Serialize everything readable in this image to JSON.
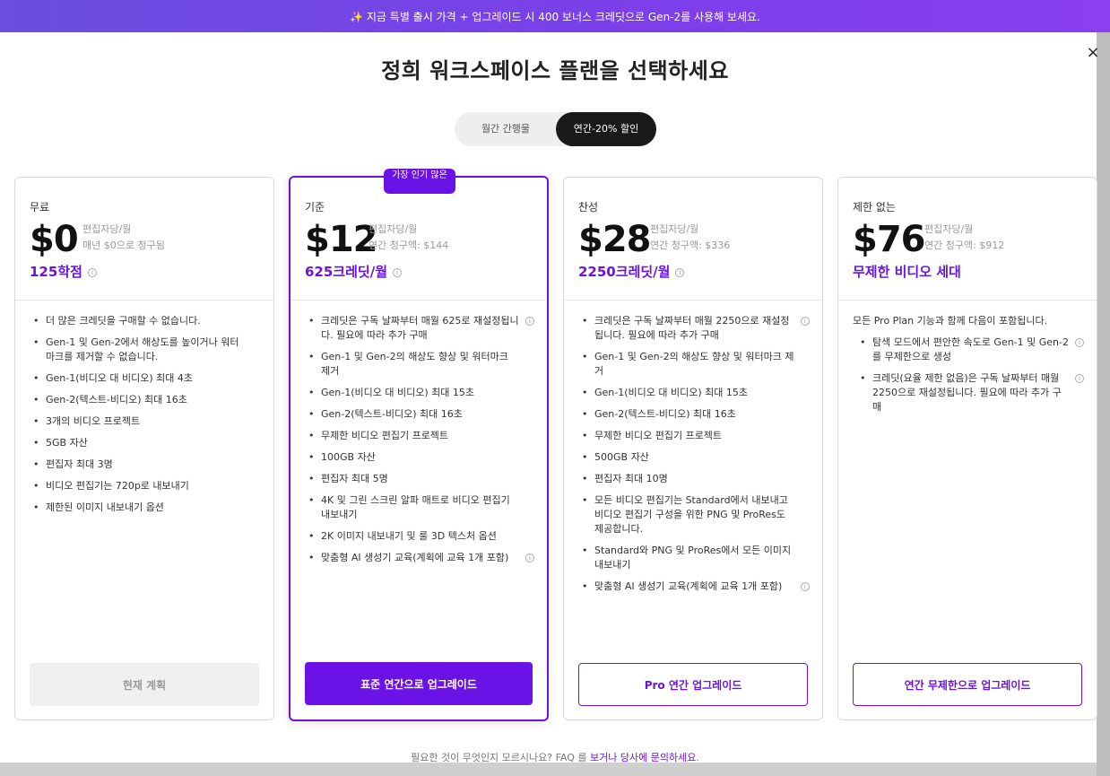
{
  "banner": {
    "text": "✨ 지금 특별 출시 가격 + 업그레이드 시 400 보너스 크레딧으로 Gen-2를 사용해 보세요."
  },
  "modal": {
    "title": "정희 워크스페이스 플랜을 선택하세요",
    "close": "×"
  },
  "billing_toggle": {
    "monthly": "월간 간행물",
    "yearly": "연간-20% 할인",
    "selected": "yearly"
  },
  "plans": [
    {
      "name": "무료",
      "price": "$0",
      "sub1": "편집자당/월",
      "sub2": "매년 $0으로 청구됨",
      "credits": "125학점",
      "features": [
        "더 많은 크레딧을 구매할 수 없습니다.",
        "Gen-1 및 Gen-2에서 해상도를 높이거나 워터마크를 제거할 수 없습니다.",
        "Gen-1(비디오 대 비디오) 최대 4초",
        "Gen-2(텍스트-비디오) 최대 16초",
        "3개의 비디오 프로젝트",
        "5GB 자산",
        "편집자 최대 3명",
        "비디오 편집기는 720p로 내보내기",
        "제한된 이미지 내보내기 옵션"
      ],
      "cta": "현재 계획"
    },
    {
      "name": "기준",
      "badge": "가장 인기 많은",
      "price": "$12",
      "sub1": "편집자당/월",
      "sub2": "연간 청구액: $144",
      "credits": "625크레딧/월",
      "features": [
        "크레딧은 구독 날짜부터 매월 625로 재설정됩니다. 필요에 따라 추가 구매",
        "Gen-1 및 Gen-2의 해상도 향상 및 워터마크 제거",
        "Gen-1(비디오 대 비디오) 최대 15초",
        "Gen-2(텍스트-비디오) 최대 16초",
        "무제한 비디오 편집기 프로젝트",
        "100GB 자산",
        "편집자 최대 5명",
        "4K 및 그린 스크린 알파 매트로 비디오 편집기 내보내기",
        "2K 이미지 내보내기 및 룰 3D 텍스처 옵션",
        "맞춤형 AI 생성기 교육(계획에 교육 1개 포함)"
      ],
      "cta": "표준 연간으로 업그레이드"
    },
    {
      "name": "찬성",
      "price": "$28",
      "sub1": "편집자당/월",
      "sub2": "연간 청구액: $336",
      "credits": "2250크레딧/월",
      "features": [
        "크레딧은 구독 날짜부터 매월 2250으로 재설정됩니다. 필요에 따라 추가 구매",
        "Gen-1 및 Gen-2의 해상도 향상 및 워터마크 제거",
        "Gen-1(비디오 대 비디오) 최대 15초",
        "Gen-2(텍스트-비디오) 최대 16초",
        "무제한 비디오 편집기 프로젝트",
        "500GB 자산",
        "편집자 최대 10명",
        "모든 비디오 편집기는 Standard에서 내보내고 비디오 편집기 구성을 위한 PNG 및 ProRes도 제공합니다.",
        "Standard와 PNG 및 ProRes에서 모든 이미지 내보내기",
        "맞춤형 AI 생성기 교육(계획에 교육 1개 포함)"
      ],
      "cta": "Pro 연간 업그레이드"
    },
    {
      "name": "제한 없는",
      "price": "$76",
      "sub1": "편집자당/월",
      "sub2": "연간 청구액: $912",
      "credits": "무제한 비디오 세대",
      "intro": "모든 Pro Plan 기능과 함께 다음이 포함됩니다.",
      "features": [
        "탐색 모드에서 편안한 속도로 Gen-1 및 Gen-2를 무제한으로 생성",
        "크레딧(요율 제한 없음)은 구독 날짜부터 매월 2250으로 재설정됩니다. 필요에 따라 추가 구매"
      ],
      "cta": "연간 무제한으로 업그레이드"
    }
  ],
  "footer": {
    "prefix": "필요한 것이 무엇인지 모르시나요? FAQ 를 ",
    "faq_link": "보거나",
    "middle": " ",
    "contact_link": "당사에 문의하세요",
    "suffix": "."
  }
}
